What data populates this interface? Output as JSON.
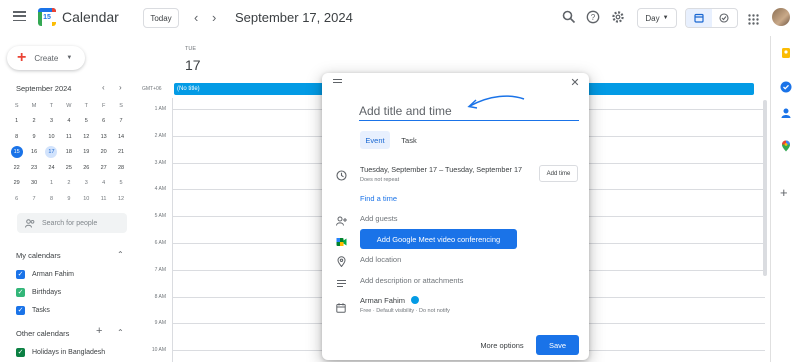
{
  "header": {
    "app_title": "Calendar",
    "logo_day": "15",
    "today_label": "Today",
    "date_title": "September 17, 2024",
    "view_label": "Day"
  },
  "sidebar": {
    "create_label": "Create",
    "mini_calendar": {
      "month_title": "September 2024",
      "weekday_headers": [
        "S",
        "M",
        "T",
        "W",
        "T",
        "F",
        "S"
      ],
      "weeks": [
        [
          "1",
          "2",
          "3",
          "4",
          "5",
          "6",
          "7"
        ],
        [
          "8",
          "9",
          "10",
          "11",
          "12",
          "13",
          "14"
        ],
        [
          "15",
          "16",
          "17",
          "18",
          "19",
          "20",
          "21"
        ],
        [
          "22",
          "23",
          "24",
          "25",
          "26",
          "27",
          "28"
        ],
        [
          "29",
          "30",
          "1",
          "2",
          "3",
          "4",
          "5"
        ],
        [
          "6",
          "7",
          "8",
          "9",
          "10",
          "11",
          "12"
        ]
      ],
      "selected_day": "15",
      "today_day": "17"
    },
    "search_people_placeholder": "Search for people",
    "my_calendars_title": "My calendars",
    "my_calendars": [
      {
        "name": "Arman Fahim",
        "color": "#1a73e8"
      },
      {
        "name": "Birthdays",
        "color": "#33b679"
      },
      {
        "name": "Tasks",
        "color": "#1a73e8"
      }
    ],
    "other_calendars_title": "Other calendars",
    "other_calendars": [
      {
        "name": "Holidays in Bangladesh",
        "color": "#0b8043"
      }
    ]
  },
  "day_view": {
    "weekday": "TUE",
    "day_number": "17",
    "timezone": "GMT+06",
    "all_day_event": "(No title)",
    "hours": [
      "1 AM",
      "2 AM",
      "3 AM",
      "4 AM",
      "5 AM",
      "6 AM",
      "7 AM",
      "8 AM",
      "9 AM",
      "10 AM"
    ]
  },
  "dialog": {
    "title_placeholder": "Add title and time",
    "tabs": [
      "Event",
      "Task"
    ],
    "date_range": "Tuesday, September 17  –  Tuesday, September 17",
    "repeat": "Does not repeat",
    "add_time_label": "Add time",
    "find_time_label": "Find a time",
    "add_guests_label": "Add guests",
    "meet_button_label": "Add Google Meet video conferencing",
    "add_location_label": "Add location",
    "add_description_label": "Add description or attachments",
    "owner_name": "Arman Fahim",
    "visibility_text": "Free · Default visibility · Do not notify",
    "more_options_label": "More options",
    "save_label": "Save"
  },
  "colors": {
    "accent": "#1a73e8",
    "event": "#039be5"
  }
}
